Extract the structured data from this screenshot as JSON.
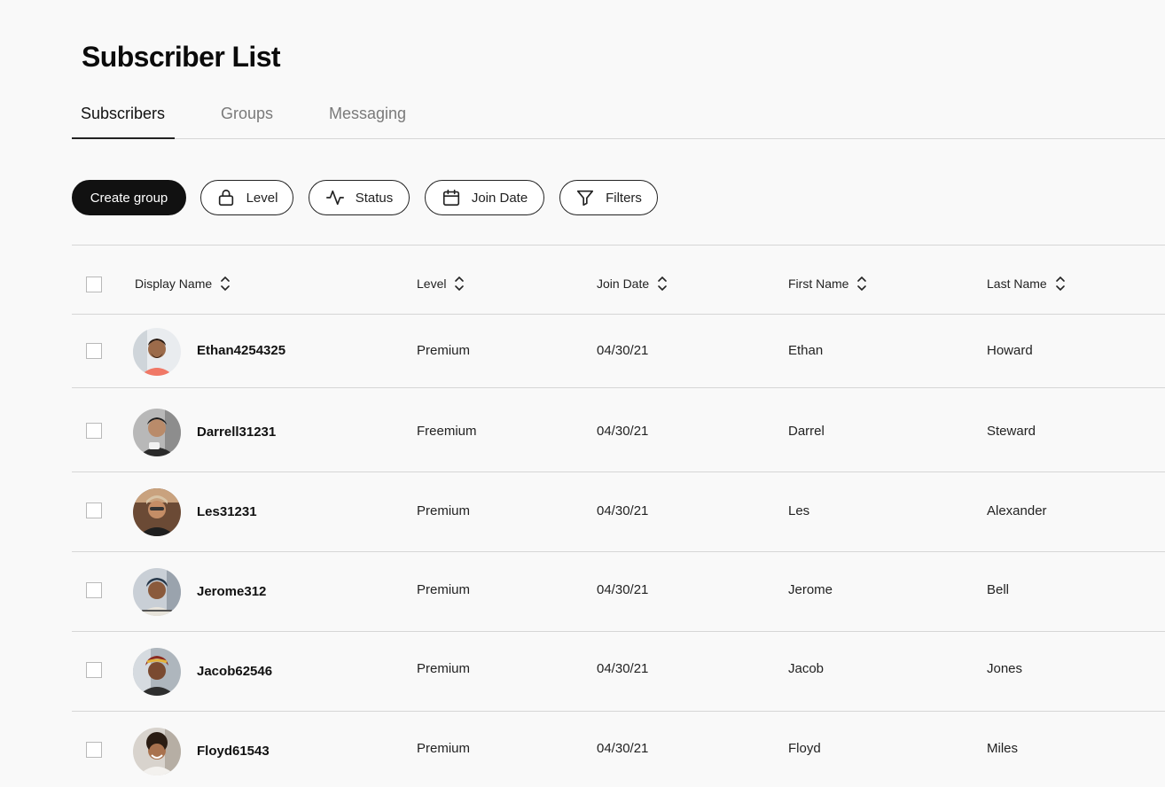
{
  "page": {
    "title": "Subscriber List"
  },
  "tabs": [
    {
      "label": "Subscribers",
      "active": true
    },
    {
      "label": "Groups",
      "active": false
    },
    {
      "label": "Messaging",
      "active": false
    }
  ],
  "toolbar": {
    "create_group": "Create group",
    "level": {
      "label": "Level",
      "icon": "lock-icon"
    },
    "status": {
      "label": "Status",
      "icon": "activity-icon"
    },
    "join_date": {
      "label": "Join Date",
      "icon": "calendar-icon"
    },
    "filters": {
      "label": "Filters",
      "icon": "filter-icon"
    }
  },
  "table": {
    "columns": [
      "Display Name",
      "Level",
      "Join Date",
      "First Name",
      "Last Name"
    ],
    "rows": [
      {
        "display_name": "Ethan4254325",
        "level": "Premium",
        "join_date": "04/30/21",
        "first_name": "Ethan",
        "last_name": "Howard"
      },
      {
        "display_name": "Darrell31231",
        "level": "Freemium",
        "join_date": "04/30/21",
        "first_name": "Darrel",
        "last_name": "Steward"
      },
      {
        "display_name": "Les31231",
        "level": "Premium",
        "join_date": "04/30/21",
        "first_name": "Les",
        "last_name": "Alexander"
      },
      {
        "display_name": "Jerome312",
        "level": "Premium",
        "join_date": "04/30/21",
        "first_name": "Jerome",
        "last_name": "Bell"
      },
      {
        "display_name": "Jacob62546",
        "level": "Premium",
        "join_date": "04/30/21",
        "first_name": "Jacob",
        "last_name": "Jones"
      },
      {
        "display_name": "Floyd61543",
        "level": "Premium",
        "join_date": "04/30/21",
        "first_name": "Floyd",
        "last_name": "Miles"
      }
    ]
  },
  "colors": {
    "primary_button": "#111111",
    "background": "#f9f9f9",
    "divider": "#d6d6d6"
  }
}
